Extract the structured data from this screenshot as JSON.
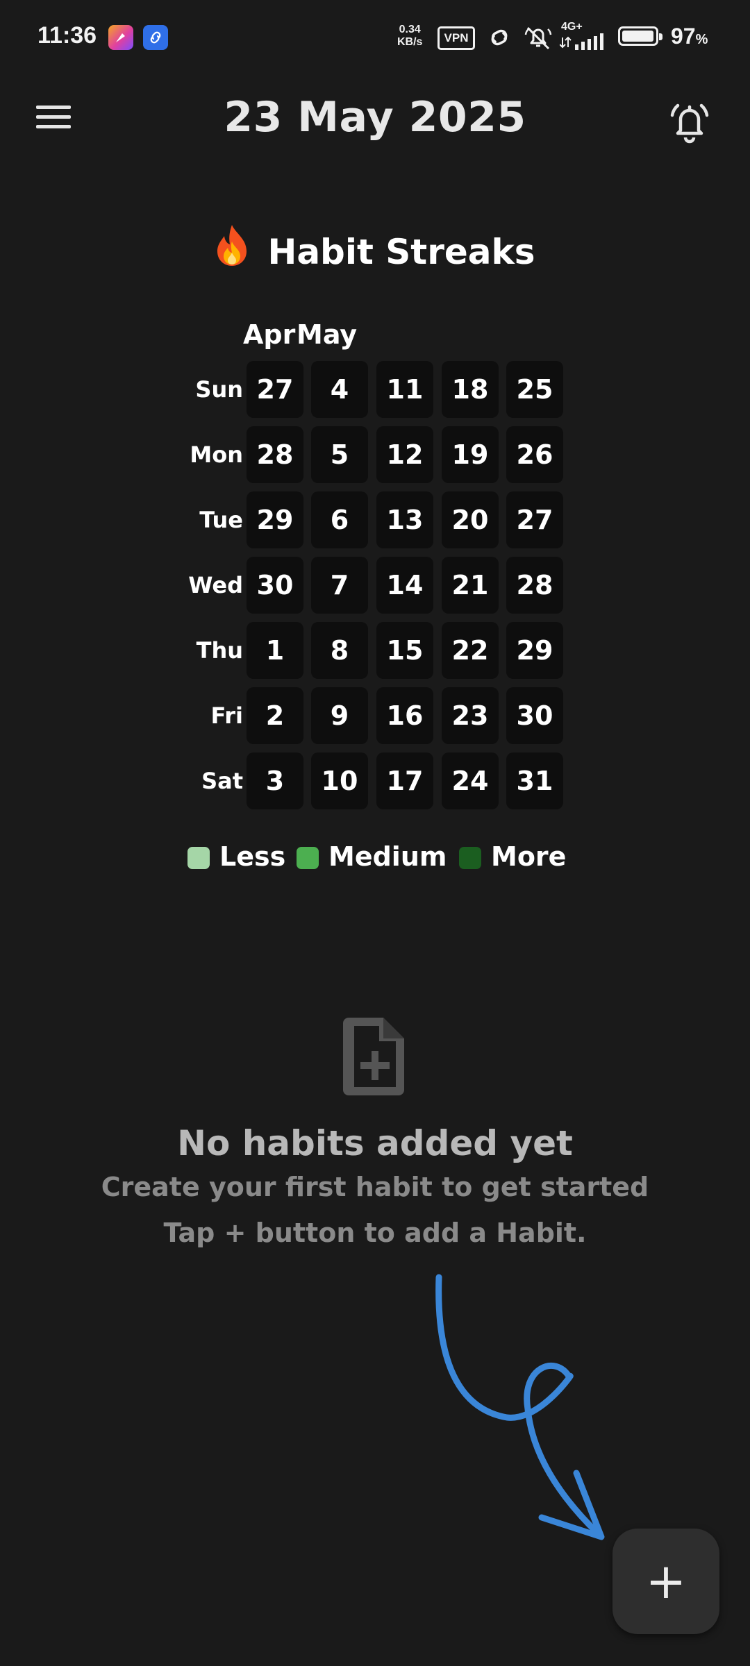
{
  "status_bar": {
    "time": "11:36",
    "net_speed_value": "0.34",
    "net_speed_unit": "KB/s",
    "vpn_label": "VPN",
    "network_type": "4G+",
    "battery_percent": "97",
    "battery_unit": "%",
    "battery_level": 0.97
  },
  "header": {
    "title": "23 May 2025",
    "menu_icon": "hamburger-menu-icon",
    "bell_icon": "alarm-bell-icon"
  },
  "streaks": {
    "title": "Habit Streaks",
    "title_icon": "fire-icon",
    "months": [
      "Apr",
      "May"
    ],
    "days": [
      "Sun",
      "Mon",
      "Tue",
      "Wed",
      "Thu",
      "Fri",
      "Sat"
    ],
    "weeks": [
      [
        "27",
        "28",
        "29",
        "30",
        "1",
        "2",
        "3"
      ],
      [
        "4",
        "5",
        "6",
        "7",
        "8",
        "9",
        "10"
      ],
      [
        "11",
        "12",
        "13",
        "14",
        "15",
        "16",
        "17"
      ],
      [
        "18",
        "19",
        "20",
        "21",
        "22",
        "23",
        "24"
      ],
      [
        "25",
        "26",
        "27",
        "28",
        "29",
        "30",
        "31"
      ]
    ],
    "legend": [
      {
        "label": "Less",
        "color": "#a5d6a7"
      },
      {
        "label": "Medium",
        "color": "#4caf50"
      },
      {
        "label": "More",
        "color": "#1b5e20"
      }
    ]
  },
  "empty_state": {
    "icon": "add-document-icon",
    "title": "No habits added yet",
    "subtitle": "Create your first habit to get started",
    "hint": "Tap + button to add a Habit."
  },
  "fab": {
    "label": "+",
    "arrow_color": "#3a86d8"
  },
  "colors": {
    "background": "#1a1a1a",
    "cell": "#0e0e0e",
    "fab": "#2e2e2e"
  }
}
